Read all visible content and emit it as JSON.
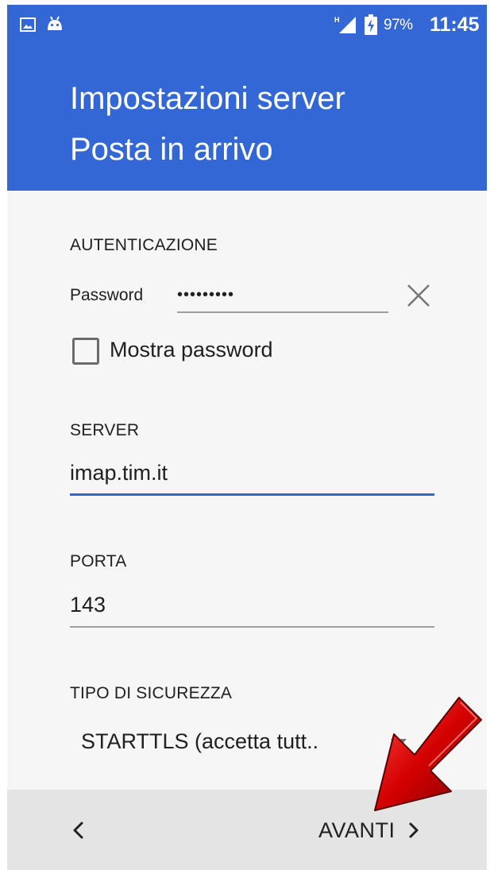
{
  "status_bar": {
    "battery_percent": "97%",
    "time": "11:45",
    "icons": [
      "gallery-icon",
      "android-icon",
      "signal-icon",
      "battery-charging-icon"
    ]
  },
  "header": {
    "title_line1": "Impostazioni server",
    "title_line2": "Posta in arrivo",
    "color": "#3367d6"
  },
  "auth": {
    "section_label": "AUTENTICAZIONE",
    "password_label": "Password",
    "password_value": "•••••••••",
    "show_password_label": "Mostra password",
    "show_password_checked": false
  },
  "server": {
    "section_label": "SERVER",
    "value": "imap.tim.it"
  },
  "port": {
    "section_label": "PORTA",
    "value": "143"
  },
  "security": {
    "section_label": "TIPO DI SICUREZZA",
    "selected": "STARTTLS (accetta tutt.."
  },
  "nav": {
    "next_label": "AVANTI"
  }
}
